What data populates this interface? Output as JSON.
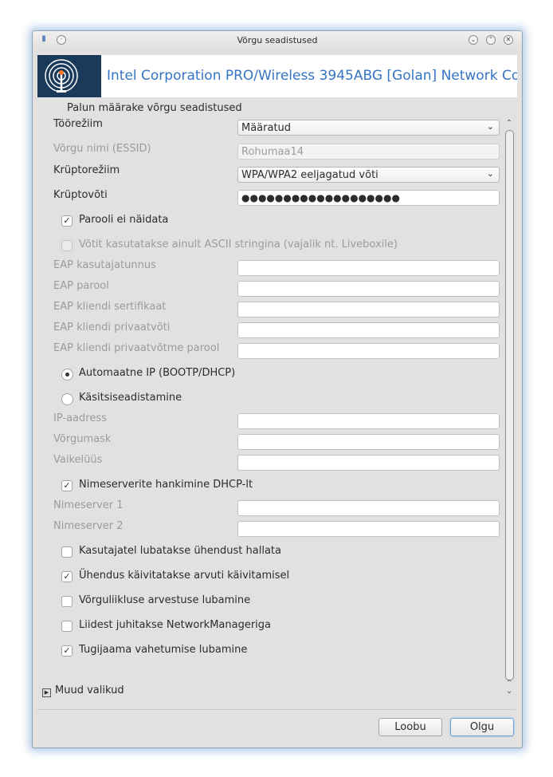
{
  "window": {
    "title": "Võrgu seadistused"
  },
  "banner": {
    "text": "Intel Corporation PRO/Wireless 3945ABG [Golan] Network Co"
  },
  "subtitle": "Palun määrake võrgu seadistused",
  "form": {
    "mode_label": "Töörežiim",
    "mode_value": "Määratud",
    "essid_label": "Võrgu nimi (ESSID)",
    "essid_value": "Rohumaa14",
    "crypto_mode_label": "Krüptorežiim",
    "crypto_mode_value": "WPA/WPA2 eeljagatud võti",
    "crypto_key_label": "Krüptovõti",
    "crypto_key_value": "●●●●●●●●●●●●●●●●●●●",
    "hide_password_label": "Parooli ei näidata",
    "ascii_key_label": "Võtit kasutatakse ainult ASCII stringina (vajalik nt. Liveboxile)",
    "eap_user_label": "EAP kasutajatunnus",
    "eap_password_label": "EAP parool",
    "eap_client_cert_label": "EAP kliendi sertifikaat",
    "eap_client_key_label": "EAP kliendi privaatvõti",
    "eap_client_key_password_label": "EAP kliendi privaatvõtme parool",
    "auto_ip_label": "Automaatne IP (BOOTP/DHCP)",
    "manual_label": "Käsitsiseadistamine",
    "ip_label": "IP-aadress",
    "netmask_label": "Võrgumask",
    "gateway_label": "Vaikelüüs",
    "dhcp_dns_label": "Nimeserverite hankimine DHCP-lt",
    "dns1_label": "Nimeserver 1",
    "dns2_label": "Nimeserver 2",
    "user_control_label": "Kasutajatel lubatakse ühendust hallata",
    "start_boot_label": "Ühendus käivitatakse arvuti käivitamisel",
    "accounting_label": "Võrguliikluse arvestuse lubamine",
    "nm_label": "Liidest juhitakse NetworkManageriga",
    "roaming_label": "Tugijaama vahetumise lubamine"
  },
  "checks": {
    "hide_password": true,
    "ascii_key": false,
    "dhcp_dns": true,
    "user_control": false,
    "start_boot": true,
    "accounting": false,
    "nm": false,
    "roaming": true
  },
  "more_options": "Muud valikud",
  "buttons": {
    "cancel": "Loobu",
    "ok": "Olgu"
  }
}
